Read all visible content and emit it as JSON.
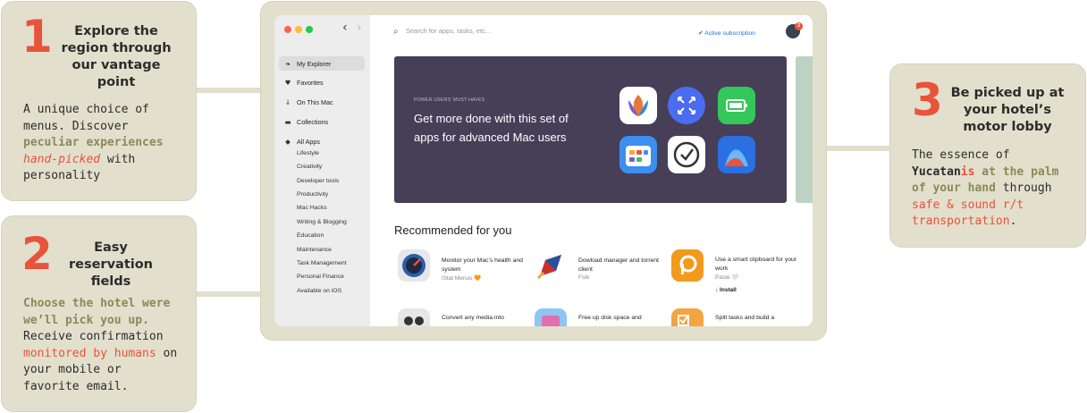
{
  "steps": [
    {
      "number": "1",
      "title": "Explore the region through our vantage point",
      "desc": {
        "plain1": "A unique choice of menus. Discover ",
        "olive": "peculiar experiences",
        "italic_red": "hand-picked",
        "plain2": " with personality"
      }
    },
    {
      "number": "2",
      "title": "Easy reservation fields",
      "desc": {
        "olive": "Choose the hotel were we’ll pick you up.",
        "plain1": " Receive confirmation ",
        "red": "monitored by humans",
        "plain2": " on your mobile or favorite email."
      }
    },
    {
      "number": "3",
      "title": "Be picked up at your hotel’s motor lobby",
      "desc": {
        "plain1": "The essence of ",
        "bold": "Yucatan",
        "red_bold": "is",
        "olive": " at the palm of your hand",
        "plain2": " through ",
        "red": "safe & sound r/t transportation",
        "plain3": "."
      }
    }
  ],
  "app": {
    "sidebar": {
      "main_items": [
        {
          "label": "My Explorer",
          "icon": "leaf-icon",
          "glyph": "❧",
          "active": true
        },
        {
          "label": "Favorites",
          "icon": "heart-icon",
          "glyph": "♥"
        },
        {
          "label": "On This Mac",
          "icon": "arrow-down-icon",
          "glyph": "↓"
        },
        {
          "label": "Collections",
          "icon": "folder-icon",
          "glyph": "▬"
        },
        {
          "label": "All Apps",
          "icon": "diamond-icon",
          "glyph": "◆"
        }
      ],
      "categories": [
        "Lifestyle",
        "Creativity",
        "Developer tools",
        "Productivity",
        "Mac Hacks",
        "Writing & Blogging",
        "Education",
        "Maintenance",
        "Task Management",
        "Personal Finance",
        "Available on iOS"
      ]
    },
    "search": {
      "placeholder": "Search for apps, tasks, etc..."
    },
    "subscription": "✔ Active subscription",
    "notification_count": "2",
    "banner": {
      "eyebrow": "POWER USERS' MUST-HAVES",
      "title": "Get more done with this set of apps for advanced Mac users",
      "color": "#473f58"
    },
    "recommended": {
      "title": "Recommended for you",
      "items": [
        {
          "desc": "Monitor your Mac’s health and system",
          "sub": "iStat Menus 🧡",
          "icon": "gauge-icon"
        },
        {
          "desc": "Dowload manager and torrent client",
          "sub": "Folx",
          "icon": "rocket-icon"
        },
        {
          "desc": "Use a smart clipboard for your work",
          "sub": "Paste 🤍",
          "install": "↓ Install",
          "icon": "paste-icon"
        },
        {
          "desc": "Convert any media into",
          "icon": "robot-icon"
        },
        {
          "desc": "Free up disk space and",
          "icon": "folder-cleanup-icon"
        },
        {
          "desc": "Split tasks and build a",
          "icon": "checklist-icon"
        }
      ]
    }
  },
  "colors": {
    "card_bg": "#e2dfcd",
    "accent_red": "#e8533a",
    "accent_olive": "#8a8a58",
    "sidebar_bg": "#ededed"
  }
}
